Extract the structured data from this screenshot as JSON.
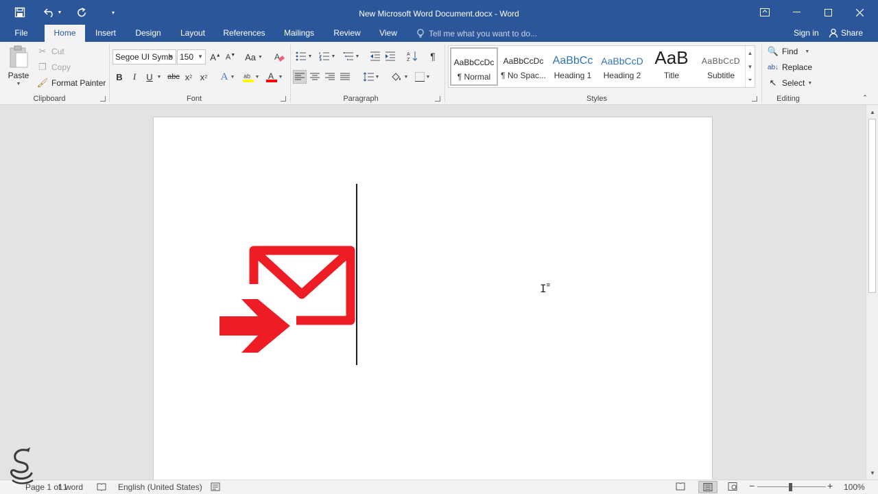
{
  "titlebar": {
    "title": "New Microsoft Word Document.docx - Word",
    "customize_icon": "customize-quick-access-icon"
  },
  "tabs": [
    "File",
    "Home",
    "Insert",
    "Design",
    "Layout",
    "References",
    "Mailings",
    "Review",
    "View"
  ],
  "active_tab": "Home",
  "tellme": {
    "placeholder": "Tell me what you want to do..."
  },
  "account": {
    "signin": "Sign in",
    "share": "Share"
  },
  "clipboard": {
    "paste": "Paste",
    "cut": "Cut",
    "copy": "Copy",
    "format_painter": "Format Painter",
    "label": "Clipboard"
  },
  "font": {
    "name": "Segoe UI Symb",
    "size": "150",
    "label": "Font",
    "change_case": "Aa",
    "bold": "B",
    "italic": "I",
    "underline": "U",
    "strike": "abc",
    "subscript": "x",
    "superscript": "x"
  },
  "paragraph": {
    "label": "Paragraph"
  },
  "styles": {
    "label": "Styles",
    "items": [
      {
        "sample": "AaBbCcDc",
        "name": "¶ Normal"
      },
      {
        "sample": "AaBbCcDc",
        "name": "¶ No Spac..."
      },
      {
        "sample": "AaBbCc",
        "name": "Heading 1"
      },
      {
        "sample": "AaBbCcD",
        "name": "Heading 2"
      },
      {
        "sample": "AaB",
        "name": "Title"
      },
      {
        "sample": "AaBbCcD",
        "name": "Subtitle"
      }
    ],
    "selected": "¶ Normal"
  },
  "editing": {
    "label": "Editing",
    "find": "Find",
    "replace": "Replace",
    "select": "Select"
  },
  "status": {
    "page": "Page 1 of 1",
    "words": "1 word",
    "language": "English (United States)",
    "zoom": "100%"
  },
  "colors": {
    "accent": "#2b579a",
    "mail_icon": "#ee1c24",
    "highlight": "#ffff00",
    "font_color": "#ff0000"
  }
}
